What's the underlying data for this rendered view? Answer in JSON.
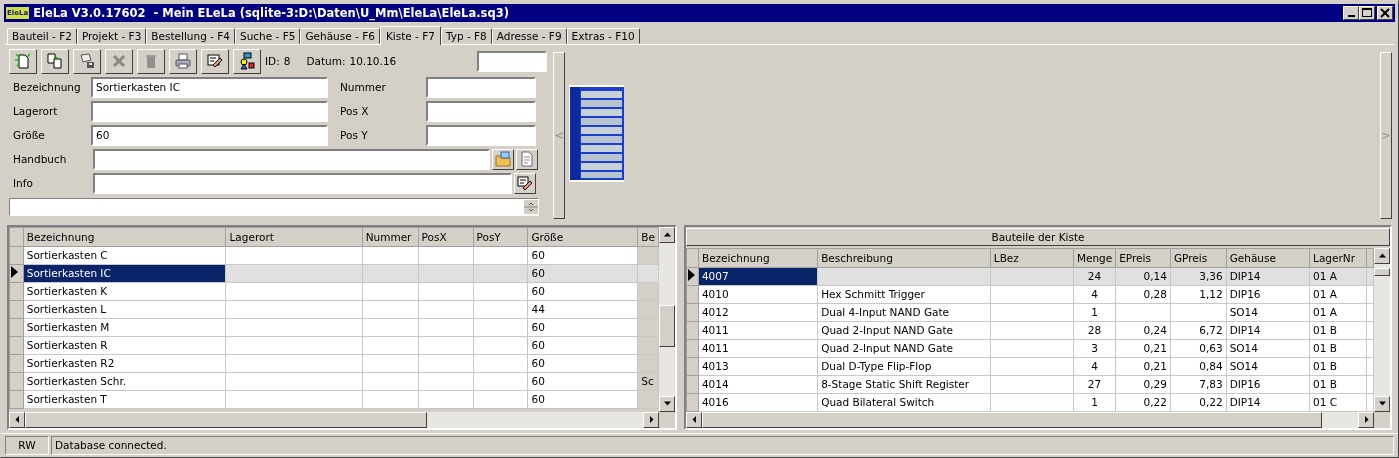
{
  "window": {
    "icon_text": "EleLa",
    "title": "EleLa V3.0.17602  - Mein ELeLa (sqlite-3:D:\\Daten\\U_Mm\\EleLa\\EleLa.sq3)"
  },
  "tabs": [
    {
      "label": "Bauteil - F2",
      "selected": false
    },
    {
      "label": "Projekt - F3",
      "selected": false
    },
    {
      "label": "Bestellung - F4",
      "selected": false
    },
    {
      "label": "Suche - F5",
      "selected": false
    },
    {
      "label": "Gehäuse - F6",
      "selected": false
    },
    {
      "label": "Kiste - F7",
      "selected": true
    },
    {
      "label": "Typ - F8",
      "selected": false
    },
    {
      "label": "Adresse - F9",
      "selected": false
    },
    {
      "label": "Extras - F10",
      "selected": false
    }
  ],
  "toolbar": [
    {
      "kind": "new",
      "disabled": false
    },
    {
      "kind": "copy",
      "disabled": false
    },
    {
      "kind": "save",
      "disabled": false
    },
    {
      "kind": "delete",
      "disabled": true
    },
    {
      "kind": "trash",
      "disabled": true
    },
    {
      "kind": "print",
      "disabled": false
    },
    {
      "kind": "edit",
      "disabled": false
    },
    {
      "kind": "shapes",
      "disabled": false
    }
  ],
  "record": {
    "id_label": "ID:",
    "id_value": "8",
    "date_label": "Datum:",
    "date_value": "10.10.16"
  },
  "fields": [
    {
      "label": "Bezeichnung",
      "value": "Sortierkasten IC"
    },
    {
      "label": "Nummer"
    },
    {
      "label": "Lagerort"
    },
    {
      "label": "Pos X"
    },
    {
      "label": "Größe",
      "value": "60"
    },
    {
      "label": "Pos Y"
    }
  ],
  "handbuch": {
    "label": "Handbuch"
  },
  "info": {
    "label": "Info"
  },
  "splitter_left": "<",
  "splitter_right": ">",
  "left_grid": {
    "columns": [
      "Bezeichnung",
      "Lagerort",
      "Nummer",
      "PosX",
      "PosY",
      "Größe",
      "Be"
    ],
    "rows": [
      {
        "cells": [
          "Sortierkasten C",
          null,
          null,
          null,
          null,
          "60",
          null
        ],
        "selected": false
      },
      {
        "cells": [
          "Sortierkasten IC",
          null,
          null,
          null,
          null,
          "60",
          null
        ],
        "selected": true
      },
      {
        "cells": [
          "Sortierkasten K",
          null,
          null,
          null,
          null,
          "60",
          null
        ],
        "selected": false
      },
      {
        "cells": [
          "Sortierkasten L",
          null,
          null,
          null,
          null,
          "44",
          null
        ],
        "selected": false
      },
      {
        "cells": [
          "Sortierkasten M",
          null,
          null,
          null,
          null,
          "60",
          null
        ],
        "selected": false
      },
      {
        "cells": [
          "Sortierkasten R",
          null,
          null,
          null,
          null,
          "60",
          null
        ],
        "selected": false
      },
      {
        "cells": [
          "Sortierkasten R2",
          null,
          null,
          null,
          null,
          "60",
          null
        ],
        "selected": false
      },
      {
        "cells": [
          "Sortierkasten Schr.",
          null,
          null,
          null,
          null,
          "60",
          "Sc"
        ],
        "selected": false
      },
      {
        "cells": [
          "Sortierkasten T",
          null,
          null,
          null,
          null,
          "60",
          null
        ],
        "selected": false
      }
    ]
  },
  "right_grid": {
    "title": "Bauteile der Kiste",
    "columns": [
      "Bezeichnung",
      "Beschreibung",
      "LBez",
      "Menge",
      "EPreis",
      "GPreis",
      "Gehäuse",
      "LagerNr"
    ],
    "rows": [
      {
        "cells": [
          "4007",
          null,
          null,
          "24",
          "0,14",
          "3,36",
          "DIP14",
          "01 A"
        ],
        "selected": true
      },
      {
        "cells": [
          "4010",
          "Hex Schmitt Trigger",
          null,
          "4",
          "0,28",
          "1,12",
          "DIP16",
          "01 A"
        ],
        "selected": false
      },
      {
        "cells": [
          "4012",
          "Dual 4-Input NAND Gate",
          null,
          "1",
          null,
          null,
          "SO14",
          "01 A"
        ],
        "selected": false
      },
      {
        "cells": [
          "4011",
          "Quad 2-Input NAND Gate",
          null,
          "28",
          "0,24",
          "6,72",
          "DIP14",
          "01 B"
        ],
        "selected": false
      },
      {
        "cells": [
          "4011",
          "Quad 2-Input NAND Gate",
          null,
          "3",
          "0,21",
          "0,63",
          "SO14",
          "01 B"
        ],
        "selected": false
      },
      {
        "cells": [
          "4013",
          "Dual D-Type Flip-Flop",
          null,
          "4",
          "0,21",
          "0,84",
          "SO14",
          "01 B"
        ],
        "selected": false
      },
      {
        "cells": [
          "4014",
          "8-Stage Static Shift Register",
          null,
          "27",
          "0,29",
          "7,83",
          "DIP16",
          "01 B"
        ],
        "selected": false
      },
      {
        "cells": [
          "4016",
          "Quad Bilateral Switch",
          null,
          "1",
          "0,22",
          "0,22",
          "DIP14",
          "01 C"
        ],
        "selected": false
      }
    ]
  },
  "status_bar": {
    "mode": "RW",
    "message": "Database connected."
  }
}
